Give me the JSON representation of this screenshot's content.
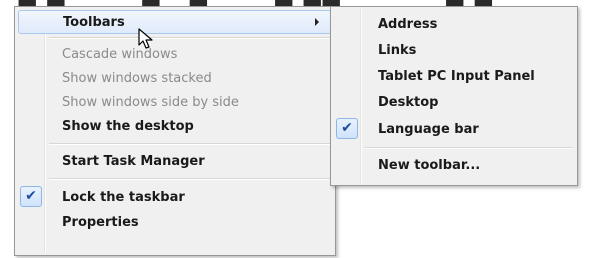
{
  "top_fringe_text": "▀▄ ▄▀ ▀▀ ▄ ▀▄▀ ▀▀▄ ▄▄▀ ▀ ▀ ▀▄ ▄▀▀ ▀ ▀▀▄ ▀ ▀▄▄ ▀▄ ▀",
  "main_menu": {
    "toolbars": "Toolbars",
    "cascade": "Cascade windows",
    "stacked": "Show windows stacked",
    "side_by_side": "Show windows side by side",
    "show_desktop": "Show the desktop",
    "task_manager": "Start Task Manager",
    "lock_taskbar": "Lock the taskbar",
    "properties": "Properties"
  },
  "sub_menu": {
    "address": "Address",
    "links": "Links",
    "tablet": "Tablet PC Input Panel",
    "desktop": "Desktop",
    "language": "Language bar",
    "new_toolbar": "New toolbar..."
  },
  "check_glyph": "✔",
  "icons": {
    "check": "check-icon",
    "submenu_arrow": "submenu-arrow-icon",
    "cursor": "mouse-pointer-icon"
  },
  "colors": {
    "menu_bg": "#f0f0f0",
    "highlight_border": "#a8c8ee",
    "check_color": "#1f4fa0",
    "disabled_text": "#8a8a8a"
  }
}
